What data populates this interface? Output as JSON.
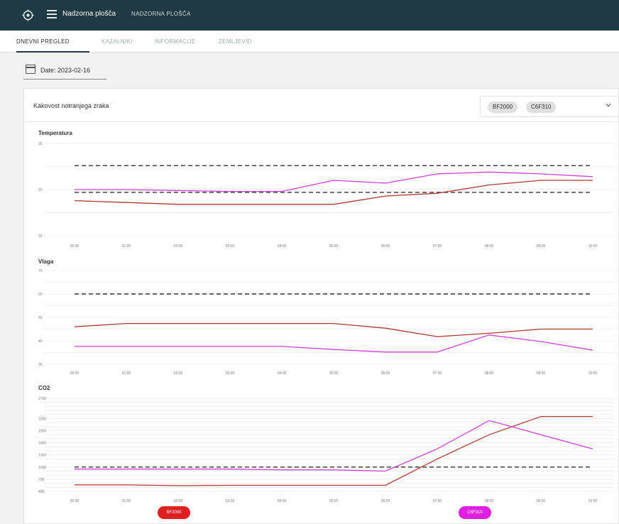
{
  "header": {
    "app_title": "Nadzorna plošča",
    "nav_link": "NADZORNA PLOŠČA"
  },
  "tabs": [
    {
      "label": "DNEVNI PREGLED",
      "active": true
    },
    {
      "label": "KAZALNIKI",
      "active": false
    },
    {
      "label": "INFORMACIJE",
      "active": false
    },
    {
      "label": "ZEMLJEVID",
      "active": false
    }
  ],
  "date": {
    "label": "Date: 2023-02-16"
  },
  "card": {
    "title": "Kakovost notranjega zraka",
    "selected_chips": [
      "BF2000",
      "C6F310"
    ]
  },
  "legend": [
    {
      "label": "BF2000",
      "color": "#e02020"
    },
    {
      "label": "C6F310",
      "color": "#e020e0"
    }
  ],
  "colors": {
    "primary": "#203a43",
    "series_a": "#b03a2e",
    "series_b": "#d040d8"
  },
  "chart_data": [
    {
      "type": "line",
      "title": "Temperatura",
      "x": [
        "00:00",
        "01:00",
        "02:00",
        "03:00",
        "04:00",
        "05:00",
        "06:00",
        "07:00",
        "08:00",
        "09:00",
        "10:00"
      ],
      "ylim": [
        15,
        25
      ],
      "yticks": [
        15,
        20,
        25
      ],
      "thresholds": [
        22.6,
        19.7
      ],
      "series": [
        {
          "values": [
            18.8,
            18.6,
            18.4,
            18.4,
            18.4,
            18.4,
            19.3,
            19.6,
            20.5,
            21,
            21
          ]
        },
        {
          "values": [
            20,
            20,
            19.9,
            19.8,
            19.8,
            21,
            20.7,
            21.7,
            21.9,
            21.7,
            21.4
          ]
        }
      ]
    },
    {
      "type": "line",
      "title": "Vlaga",
      "x": [
        "00:00",
        "01:00",
        "02:00",
        "03:00",
        "04:00",
        "05:00",
        "06:00",
        "07:00",
        "08:00",
        "09:00",
        "10:00"
      ],
      "ylim": [
        30,
        70
      ],
      "yticks": [
        30,
        40,
        50,
        60,
        70
      ],
      "thresholds": [
        60
      ],
      "series": [
        {
          "values": [
            46,
            47.4,
            47.4,
            47.4,
            47.4,
            47.4,
            45.4,
            41.8,
            43.2,
            45,
            45
          ]
        },
        {
          "values": [
            37.6,
            37.6,
            37.6,
            37.6,
            37.6,
            36.3,
            35.2,
            35.2,
            42.5,
            39.7,
            36
          ]
        }
      ]
    },
    {
      "type": "line",
      "title": "CO2",
      "x": [
        "00:00",
        "01:00",
        "02:00",
        "03:00",
        "04:00",
        "05:00",
        "06:00",
        "07:00",
        "08:00",
        "09:00",
        "10:00"
      ],
      "ylim": [
        400,
        2700
      ],
      "yticks": [
        400,
        700,
        1000,
        1300,
        1600,
        1900,
        2200,
        2700
      ],
      "thresholds": [
        1000
      ],
      "series": [
        {
          "values": [
            560,
            560,
            540,
            550,
            550,
            550,
            550,
            1200,
            1800,
            2250,
            2250
          ]
        },
        {
          "values": [
            950,
            950,
            950,
            950,
            930,
            930,
            900,
            1450,
            2150,
            1800,
            1450
          ]
        }
      ]
    }
  ]
}
